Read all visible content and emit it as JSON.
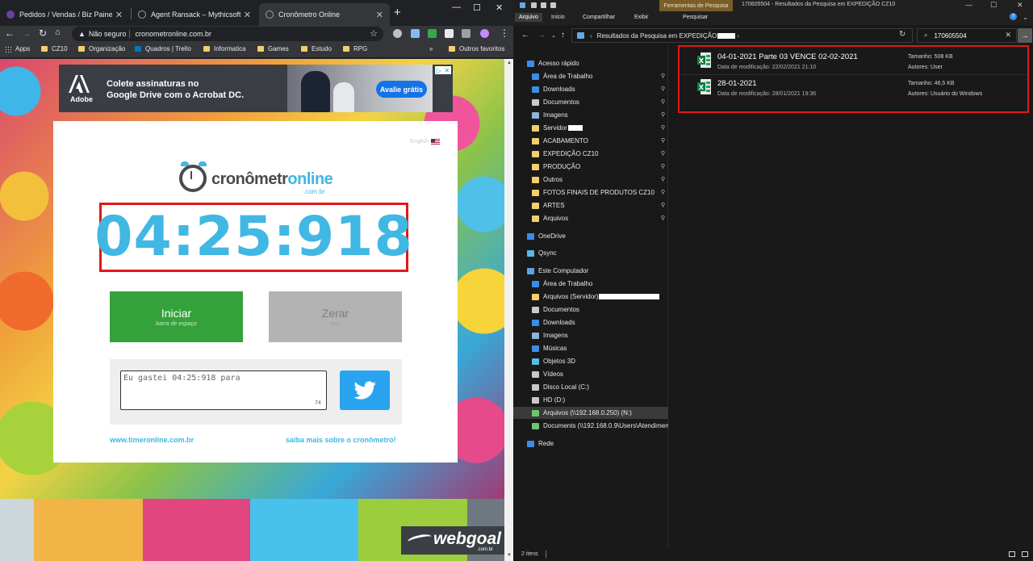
{
  "chrome": {
    "tabs": [
      {
        "title": "Pedidos / Vendas / Biz Painel",
        "fav_color": "#6b3fa0"
      },
      {
        "title": "Agent Ransack – Mythicsoft",
        "fav_color": "#9aa0a6"
      },
      {
        "title": "Cronômetro Online",
        "fav_color": "#9aa0a6"
      }
    ],
    "new_tab": "+",
    "address": {
      "security_label": "Não seguro",
      "url": "cronometronline.com.br"
    },
    "bookmarks": [
      "Apps",
      "CZ10",
      "Organização",
      "Quadros | Trello",
      "Informatica",
      "Games",
      "Estudo",
      "RPG"
    ],
    "bookmarks_overflow": "»",
    "other_bookmarks": "Outros favoritos"
  },
  "ad": {
    "brand": "Adobe",
    "copy_line1": "Colete assinaturas no",
    "copy_line2": "Google Drive com o Acrobat DC.",
    "cta": "Avalie grátis"
  },
  "timer": {
    "language_link": "English",
    "brand_part1": "cronômetr",
    "brand_part2": "online",
    "brand_sub": ".com.br",
    "display": "04:25:918",
    "start_label": "Iniciar",
    "start_hint": "barra de espaço",
    "reset_label": "Zerar",
    "reset_hint": "esc",
    "share_text": "Eu gastei 04:25:918 para ",
    "char_count": "74",
    "link_left": "www.timeronline.com.br",
    "link_right": "saiba mais sobre o cronômetro!"
  },
  "footer": {
    "logo": "webgoal",
    "logo_sub": ".com.br",
    "stripe_colors": [
      "#ccd7dc",
      "#f2b447",
      "#e1467e",
      "#48c1ec",
      "#9ccd3c",
      "#6f7880"
    ]
  },
  "explorer": {
    "context_tab": "Ferramentas de Pesquisa",
    "window_title": "170605504 - Resultados da Pesquisa em EXPEDIÇÃO CZ10",
    "ribbon_tabs": [
      "Arquivo",
      "Início",
      "Compartilhar",
      "Exibir",
      "Pesquisar"
    ],
    "breadcrumb": "Resultados da Pesquisa em EXPEDIÇÃO",
    "search_query": "170605504",
    "nav": [
      {
        "label": "Acesso rápido",
        "color": "#3a8ee6",
        "level": 0,
        "pinned": false
      },
      {
        "label": "Área de Trabalho",
        "color": "#3a8ee6",
        "level": 1,
        "pinned": true
      },
      {
        "label": "Downloads",
        "color": "#3a8ee6",
        "level": 1,
        "pinned": true
      },
      {
        "label": "Documentos",
        "color": "#c9c9c9",
        "level": 1,
        "pinned": true
      },
      {
        "label": "Imagens",
        "color": "#8fb4d9",
        "level": 1,
        "pinned": true
      },
      {
        "label": "Servidor",
        "color": "#f2cf6b",
        "level": 1,
        "pinned": true,
        "redacted": true
      },
      {
        "label": "ACABAMENTO",
        "color": "#f2cf6b",
        "level": 1,
        "pinned": true
      },
      {
        "label": "EXPEDIÇÃO CZ10",
        "color": "#f2cf6b",
        "level": 1,
        "pinned": true
      },
      {
        "label": "PRODUÇÃO",
        "color": "#f2cf6b",
        "level": 1,
        "pinned": true
      },
      {
        "label": "Outros",
        "color": "#f2cf6b",
        "level": 1,
        "pinned": true
      },
      {
        "label": "FOTOS FINAIS DE PRODUTOS CZ10",
        "color": "#f2cf6b",
        "level": 1,
        "pinned": true
      },
      {
        "label": "ARTES",
        "color": "#f2cf6b",
        "level": 1,
        "pinned": true
      },
      {
        "label": "Arquivos",
        "color": "#f2cf6b",
        "level": 1,
        "pinned": true
      },
      {
        "label": "OneDrive",
        "color": "#3a8ee6",
        "level": 0,
        "pinned": false
      },
      {
        "label": "Qsync",
        "color": "#5cb8e6",
        "level": 0,
        "pinned": false
      },
      {
        "label": "Este Computador",
        "color": "#5ba3e6",
        "level": 0,
        "pinned": false
      },
      {
        "label": "Área de Trabalho",
        "color": "#3a8ee6",
        "level": 1,
        "pinned": false
      },
      {
        "label": "Arquivos (Servidor)",
        "color": "#f2cf6b",
        "level": 1,
        "pinned": false,
        "redacted_long": true
      },
      {
        "label": "Documentos",
        "color": "#c9c9c9",
        "level": 1,
        "pinned": false
      },
      {
        "label": "Downloads",
        "color": "#3a8ee6",
        "level": 1,
        "pinned": false
      },
      {
        "label": "Imagens",
        "color": "#8fb4d9",
        "level": 1,
        "pinned": false
      },
      {
        "label": "Músicas",
        "color": "#3a8ee6",
        "level": 1,
        "pinned": false
      },
      {
        "label": "Objetos 3D",
        "color": "#5cb8e6",
        "level": 1,
        "pinned": false
      },
      {
        "label": "Vídeos",
        "color": "#c9c9c9",
        "level": 1,
        "pinned": false
      },
      {
        "label": "Disco Local (C:)",
        "color": "#c9c9c9",
        "level": 1,
        "pinned": false
      },
      {
        "label": "HD (D:)",
        "color": "#c9c9c9",
        "level": 1,
        "pinned": false
      },
      {
        "label": "Arquivos (\\\\192.168.0.250) (N:)",
        "color": "#6cc66c",
        "level": 1,
        "pinned": false,
        "selected": true
      },
      {
        "label": "Documents (\\\\192.168.0.9\\Users\\Atendimen",
        "color": "#6cc66c",
        "level": 1,
        "pinned": false
      },
      {
        "label": "Rede",
        "color": "#3a8ee6",
        "level": 0,
        "pinned": false
      }
    ],
    "files": [
      {
        "name": "04-01-2021 Parte 03 VENCE 02-02-2021",
        "modified": "Data de modificação: 22/02/2021 21:10",
        "size": "Tamanho: 508 KB",
        "authors": "Autores: User"
      },
      {
        "name": "28-01-2021",
        "modified": "Data de modificação: 28/01/2021 19:36",
        "size": "Tamanho: 46,5 KB",
        "authors": "Autores: Usuário do Windows"
      }
    ],
    "status_count": "2 itens"
  }
}
